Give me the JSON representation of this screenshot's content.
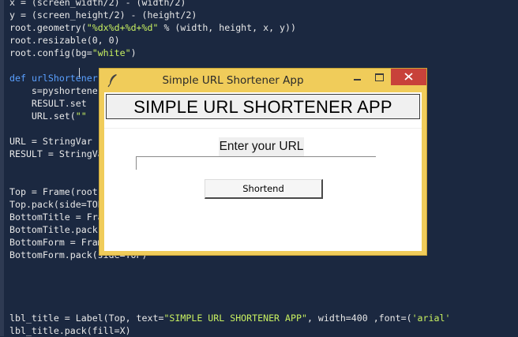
{
  "editor": {
    "lines": [
      {
        "parts": [
          {
            "t": "x = (screen_width/2) - (width/2)",
            "c": ""
          }
        ]
      },
      {
        "parts": [
          {
            "t": "y = (screen_height/2) - (height/2)",
            "c": ""
          }
        ]
      },
      {
        "parts": [
          {
            "t": "root.geometry(",
            "c": ""
          },
          {
            "t": "\"%dx%d+%d+%d\"",
            "c": "str"
          },
          {
            "t": " % (width, height, x, y))",
            "c": ""
          }
        ]
      },
      {
        "parts": [
          {
            "t": "root.resizable(0, 0)",
            "c": ""
          }
        ]
      },
      {
        "parts": [
          {
            "t": "root.config(bg=",
            "c": ""
          },
          {
            "t": "\"white\"",
            "c": "str"
          },
          {
            "t": ")",
            "c": ""
          }
        ]
      },
      {
        "parts": []
      },
      {
        "parts": [
          {
            "t": "def",
            "c": "kw"
          },
          {
            "t": " ",
            "c": ""
          },
          {
            "t": "urlShortener",
            "c": "fn"
          }
        ]
      },
      {
        "parts": [
          {
            "t": "    s=pyshorteners",
            "c": ""
          }
        ]
      },
      {
        "parts": [
          {
            "t": "    RESULT.set",
            "c": ""
          }
        ]
      },
      {
        "parts": [
          {
            "t": "    URL.set(",
            "c": ""
          },
          {
            "t": "\"\"",
            "c": "str"
          }
        ]
      },
      {
        "parts": []
      },
      {
        "parts": [
          {
            "t": "URL = StringVar",
            "c": ""
          }
        ]
      },
      {
        "parts": [
          {
            "t": "RESULT = StringVar",
            "c": ""
          }
        ]
      },
      {
        "parts": []
      },
      {
        "parts": []
      },
      {
        "parts": [
          {
            "t": "Top = Frame(root",
            "c": ""
          }
        ]
      },
      {
        "parts": [
          {
            "t": "Top.pack(side=TOP)",
            "c": ""
          }
        ]
      },
      {
        "parts": [
          {
            "t": "BottomTitle = Frame",
            "c": ""
          }
        ]
      },
      {
        "parts": [
          {
            "t": "BottomTitle.pack",
            "c": ""
          }
        ]
      },
      {
        "parts": [
          {
            "t": "BottomForm = Frame",
            "c": ""
          }
        ]
      },
      {
        "parts": [
          {
            "t": "BottomForm.pack(side=TOP)",
            "c": ""
          }
        ]
      },
      {
        "parts": []
      },
      {
        "parts": []
      },
      {
        "parts": []
      },
      {
        "parts": []
      },
      {
        "parts": [
          {
            "t": "lbl_title = Label(Top, text=",
            "c": ""
          },
          {
            "t": "\"SIMPLE URL SHORTENER APP\"",
            "c": "str"
          },
          {
            "t": ", width=400 ,font=(",
            "c": ""
          },
          {
            "t": "'arial'",
            "c": "str"
          }
        ]
      },
      {
        "parts": [
          {
            "t": "lbl_title.pack(fill=X)",
            "c": ""
          }
        ]
      }
    ]
  },
  "window": {
    "title": "Simple URL Shortener App",
    "icon": "feather-icon",
    "controls": [
      "minimize-icon",
      "maximize-icon",
      "close-icon"
    ]
  },
  "app": {
    "header": "SIMPLE URL SHORTENER APP",
    "url_label": "Enter your URL",
    "url_value": "",
    "button_label": "Shortend"
  },
  "colors": {
    "editor_bg": "#1b2840",
    "keyword": "#5aa0ff",
    "string": "#c8f060",
    "window_frame": "#f0cc5a",
    "close_button": "#c8423a"
  }
}
